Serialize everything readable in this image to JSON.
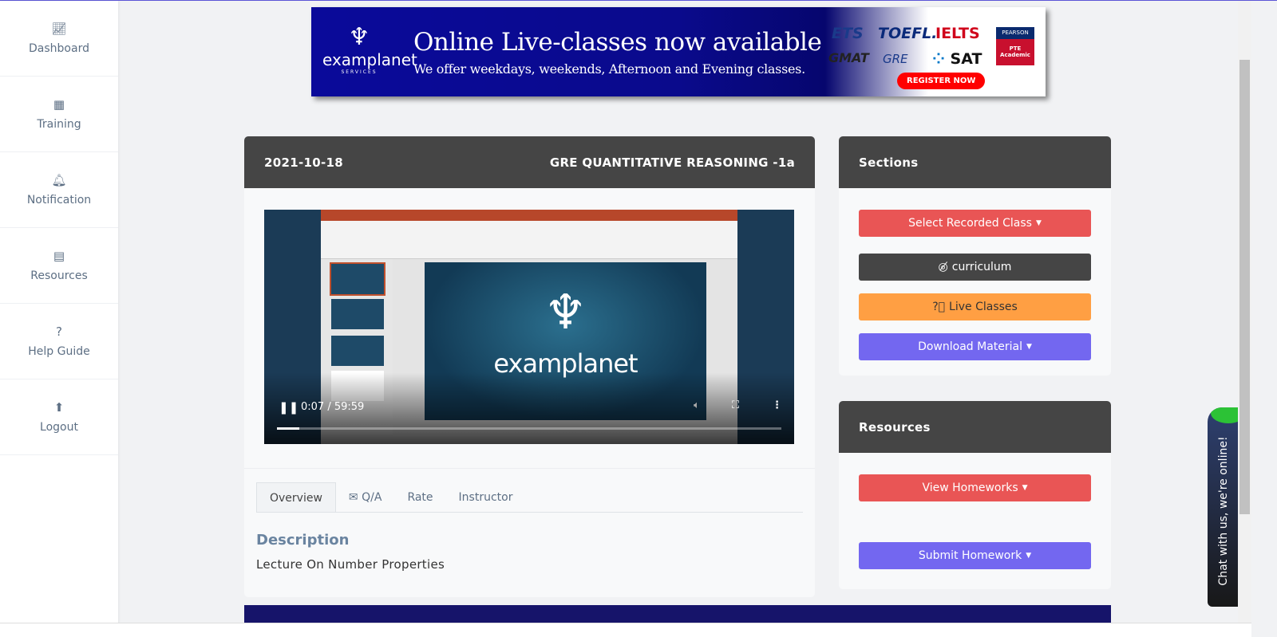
{
  "sidebar": {
    "items": [
      {
        "label": "Dashboard",
        "icon": "chart-area-icon"
      },
      {
        "label": "Training",
        "icon": "grid-icon"
      },
      {
        "label": "Notification",
        "icon": "bell-icon"
      },
      {
        "label": "Resources",
        "icon": "document-icon"
      },
      {
        "label": "Help Guide",
        "icon": "question-icon"
      },
      {
        "label": "Logout",
        "icon": "arrow-up-icon"
      }
    ]
  },
  "banner": {
    "logo": "examplanet",
    "logo_sub": "SERVICES",
    "headline": "Online Live-classes now available",
    "subline": "We offer weekdays, weekends, Afternoon and Evening classes.",
    "brands": [
      "ETS",
      "TOEFL.",
      "IELTS",
      "GMAT",
      "GRE",
      "SAT"
    ],
    "pearson_top": "PEARSON",
    "pearson_bottom": "PTE Academic",
    "cta": "REGISTER NOW"
  },
  "lesson": {
    "date": "2021-10-18",
    "title": "GRE QUANTITATIVE REASONING -1a",
    "video": {
      "current_time": "0:07",
      "duration": "59:59",
      "time_display": "0:07 / 59:59",
      "progress_percent": 0.2,
      "slide_logo": "examplanet"
    },
    "tabs": [
      {
        "label": "Overview",
        "active": true
      },
      {
        "label": "Q/A",
        "icon": "envelope-icon"
      },
      {
        "label": "Rate"
      },
      {
        "label": "Instructor"
      }
    ],
    "description_heading": "Description",
    "description": "Lecture On Number Properties"
  },
  "sections": {
    "title": "Sections",
    "buttons": [
      {
        "label": "Select Recorded Class",
        "color": "#e95555"
      },
      {
        "label": "curriculum",
        "color": "#454545",
        "icon": "eye-slash-icon"
      },
      {
        "label": "Live Classes",
        "color": "#ff9f43",
        "icon": "question-circle-icon"
      },
      {
        "label": "Download Material",
        "color": "#7367f0"
      }
    ]
  },
  "resources": {
    "title": "Resources",
    "buttons": [
      {
        "label": "View Homeworks",
        "color": "#e95555"
      },
      {
        "label": "Submit Homework",
        "color": "#7367f0"
      }
    ]
  },
  "chat": {
    "label": "Chat with us, we're online!"
  }
}
